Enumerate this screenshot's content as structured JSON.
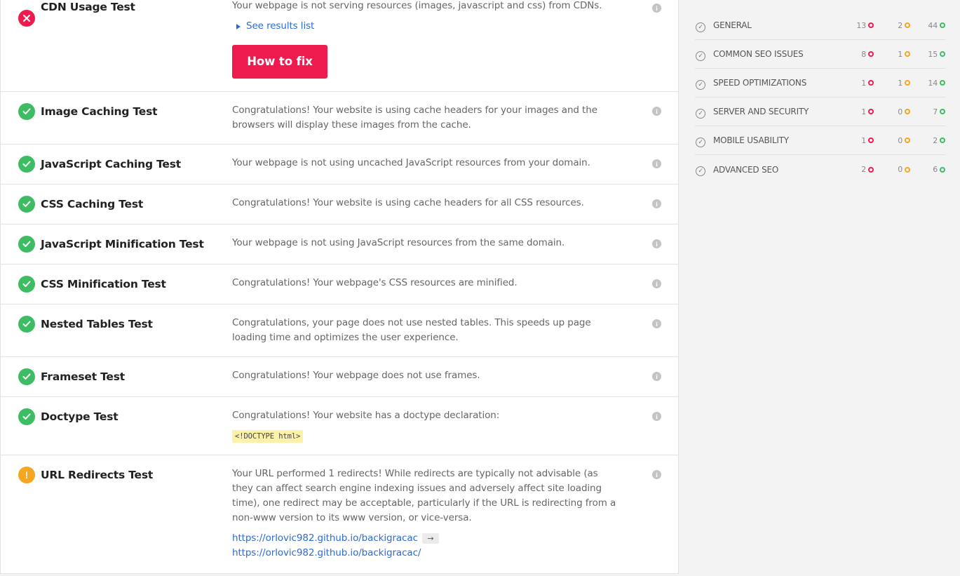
{
  "tests": [
    {
      "name": "CDN Usage Test",
      "status": "fail",
      "description": "Your webpage is not serving resources (images, javascript and css) from CDNs.",
      "see_results": "See results list",
      "fix_label": "How to fix"
    },
    {
      "name": "Image Caching Test",
      "status": "pass",
      "description": "Congratulations! Your website is using cache headers for your images and the browsers will display these images from the cache."
    },
    {
      "name": "JavaScript Caching Test",
      "status": "pass",
      "description": "Your webpage is not using uncached JavaScript resources from your domain."
    },
    {
      "name": "CSS Caching Test",
      "status": "pass",
      "description": "Congratulations! Your website is using cache headers for all CSS resources."
    },
    {
      "name": "JavaScript Minification Test",
      "status": "pass",
      "description": "Your webpage is not using JavaScript resources from the same domain."
    },
    {
      "name": "CSS Minification Test",
      "status": "pass",
      "description": "Congratulations! Your webpage's CSS resources are minified."
    },
    {
      "name": "Nested Tables Test",
      "status": "pass",
      "description": "Congratulations, your page does not use nested tables. This speeds up page loading time and optimizes the user experience."
    },
    {
      "name": "Frameset Test",
      "status": "pass",
      "description": "Congratulations! Your webpage does not use frames."
    },
    {
      "name": "Doctype Test",
      "status": "pass",
      "description": "Congratulations! Your website has a doctype declaration:",
      "code": "<!DOCTYPE html>"
    },
    {
      "name": "URL Redirects Test",
      "status": "warn",
      "description": "Your URL performed 1 redirects! While redirects are typically not advisable (as they can affect search engine indexing issues and adversely affect site loading time), one redirect may be acceptable, particularly if the URL is redirecting from a non-www version to its www version, or vice-versa.",
      "redirect_from": "https://orlovic982.github.io/backigracac",
      "redirect_to": "https://orlovic982.github.io/backigracac/"
    }
  ],
  "sidebar": {
    "categories": [
      {
        "label": "GENERAL",
        "failed": "13",
        "warnings": "2",
        "passed": "44"
      },
      {
        "label": "COMMON SEO ISSUES",
        "failed": "8",
        "warnings": "1",
        "passed": "15"
      },
      {
        "label": "SPEED OPTIMIZATIONS",
        "failed": "1",
        "warnings": "1",
        "passed": "14"
      },
      {
        "label": "SERVER AND SECURITY",
        "failed": "1",
        "warnings": "0",
        "passed": "7"
      },
      {
        "label": "MOBILE USABILITY",
        "failed": "1",
        "warnings": "0",
        "passed": "2"
      },
      {
        "label": "ADVANCED SEO",
        "failed": "2",
        "warnings": "0",
        "passed": "6"
      }
    ]
  },
  "colors": {
    "fail": "#ee1c4e",
    "pass": "#3dbc63",
    "warn": "#f5a623",
    "link": "#2d6bd8"
  }
}
